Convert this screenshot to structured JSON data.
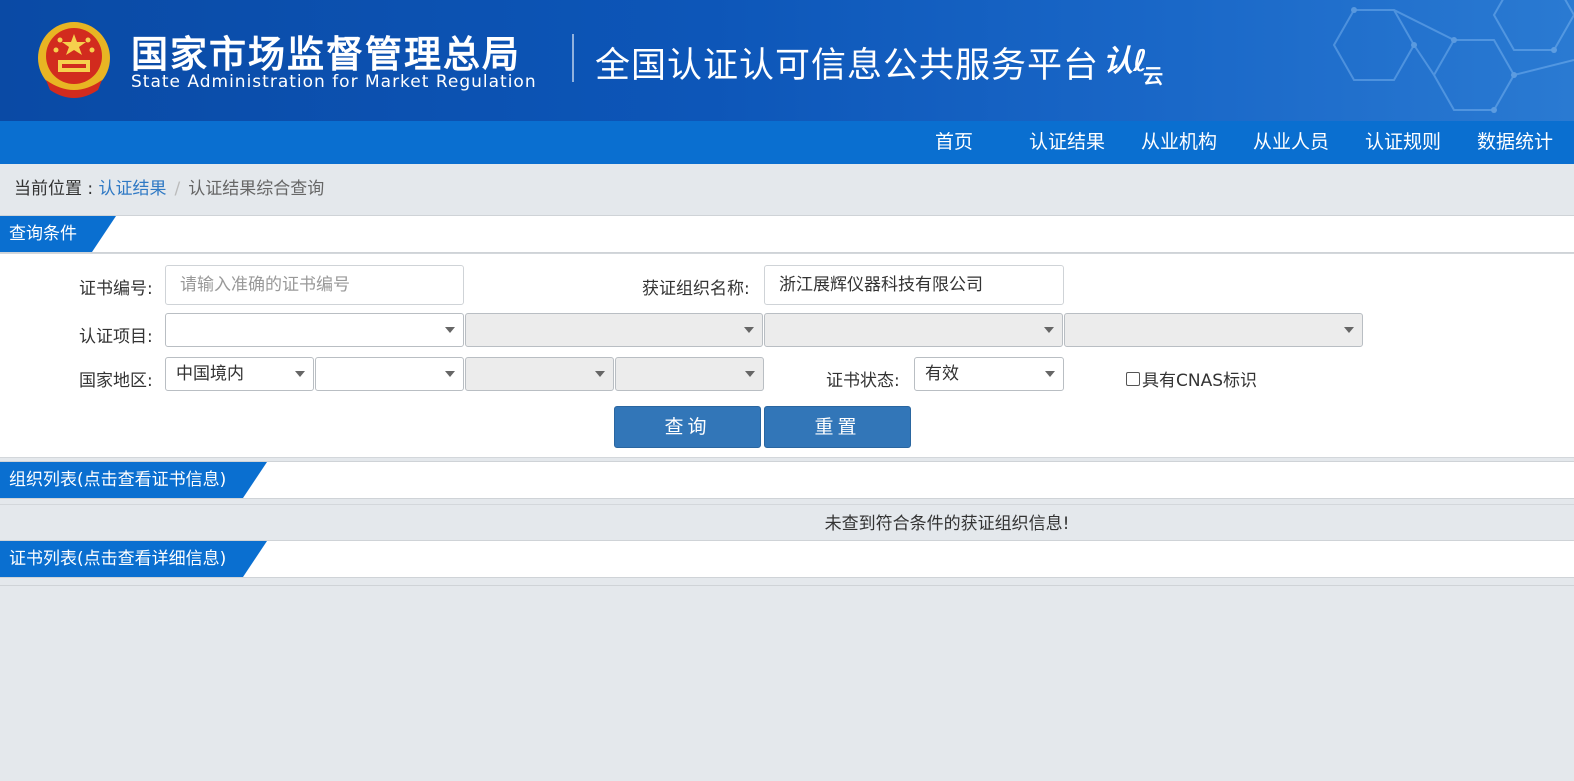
{
  "header": {
    "org_cn": "国家市场监督管理总局",
    "org_en": "State Administration  for  Market Regulation",
    "platform": "全国认证认可信息公共服务平台",
    "logo_main": "认",
    "logo_sub": "云"
  },
  "nav": {
    "items": [
      "首页",
      "认证结果",
      "从业机构",
      "从业人员",
      "认证规则",
      "数据统计"
    ]
  },
  "breadcrumb": {
    "prefix": "当前位置 : ",
    "link": "认证结果",
    "separator": "/",
    "current": "认证结果综合查询"
  },
  "query": {
    "section_title": "查询条件",
    "cert_no_label": "证书编号:",
    "cert_no_placeholder": "请输入准确的证书编号",
    "org_name_label": "获证组织名称:",
    "org_name_value": "浙江展辉仪器科技有限公司",
    "project_label": "认证项目:",
    "region_label": "国家地区:",
    "region_value": "中国境内",
    "status_label": "证书状态:",
    "status_value": "有效",
    "cnas_label": "具有CNAS标识",
    "search_button": "查询",
    "reset_button": "重置"
  },
  "org_list": {
    "section_title": "组织列表(点击查看证书信息)",
    "empty_message": "未查到符合条件的获证组织信息!"
  },
  "cert_list": {
    "section_title": "证书列表(点击查看详细信息)"
  },
  "colors": {
    "banner": "#0d56b8",
    "nav": "#0a6fd0",
    "button": "#3276b8",
    "link": "#2f79c4",
    "page_bg": "#e4e8ec"
  }
}
